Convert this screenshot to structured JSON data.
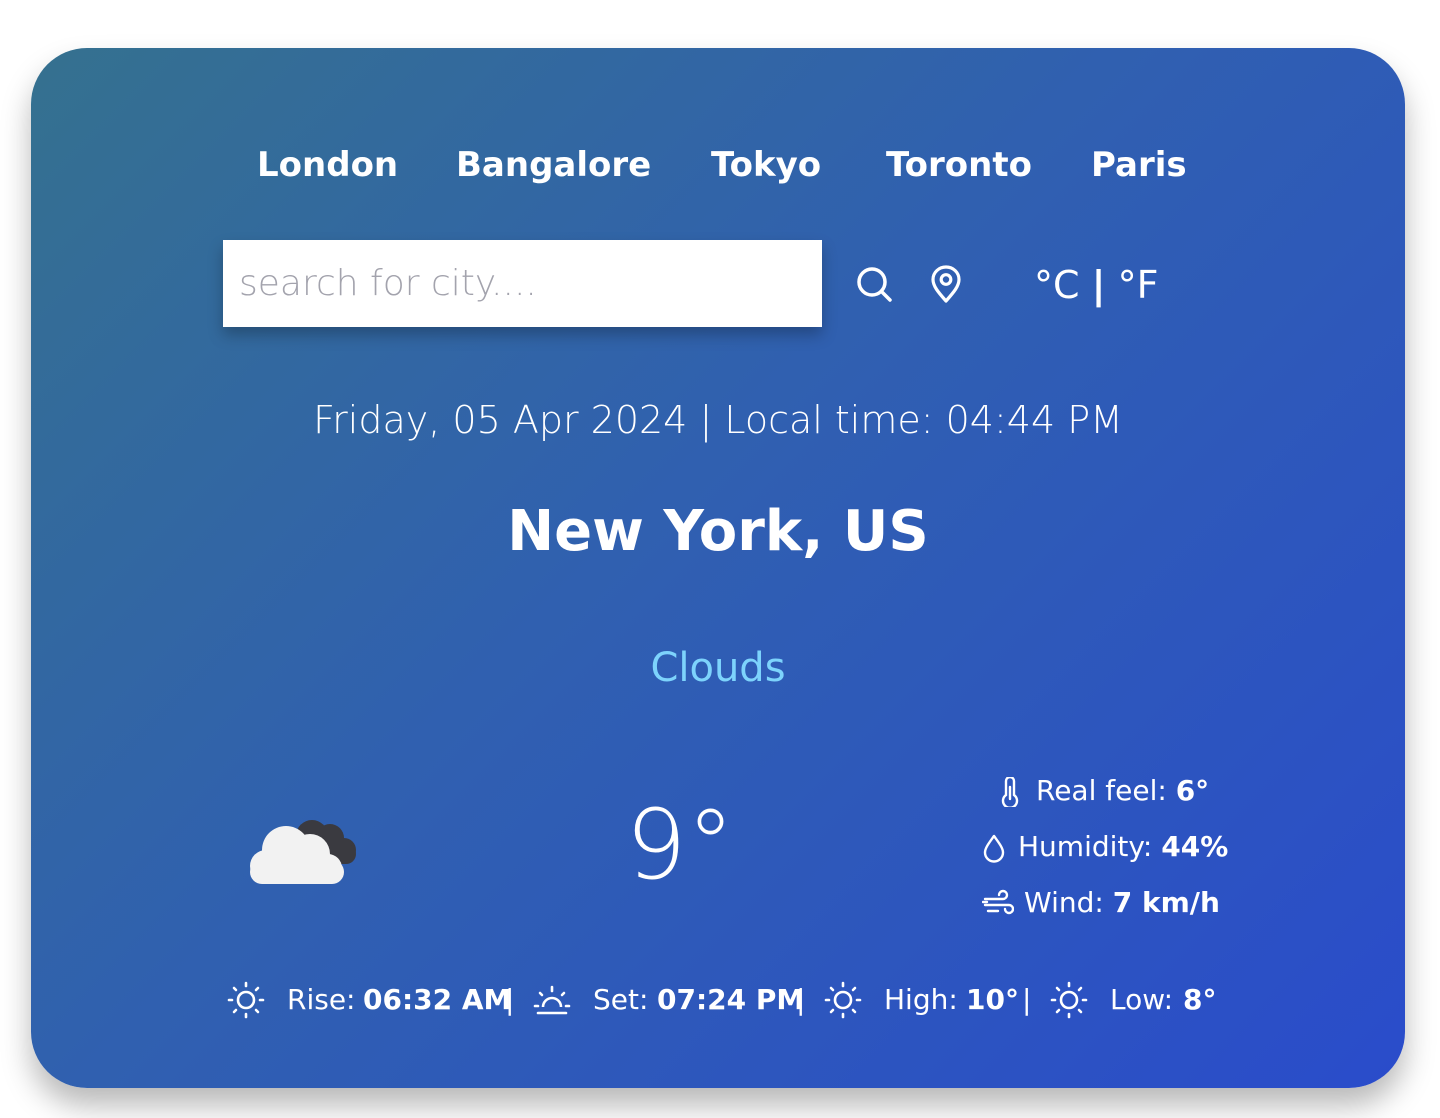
{
  "nav": {
    "cities": [
      "London",
      "Bangalore",
      "Tokyo",
      "Toronto",
      "Paris"
    ]
  },
  "search": {
    "placeholder": "search for city....",
    "search_icon": "search-icon",
    "location_icon": "map-pin-icon"
  },
  "units": {
    "celsius": "°C",
    "separator": "|",
    "fahrenheit": "°F"
  },
  "date_line": "Friday, 05 Apr 2024 | Local time: 04:44 PM",
  "location": "New York, US",
  "condition": "Clouds",
  "condition_color": "#7dd3fc",
  "current": {
    "icon": "cloudy-icon",
    "temperature": "9°"
  },
  "details": {
    "real_feel_label": "Real feel:",
    "real_feel_value": "6°",
    "humidity_label": "Humidity:",
    "humidity_value": "44%",
    "wind_label": "Wind:",
    "wind_value": "7 km/h"
  },
  "bottom": {
    "rise_label": "Rise:",
    "rise_value": "06:32 AM",
    "set_label": "Set:",
    "set_value": "07:24 PM",
    "high_label": "High:",
    "high_value": "10°",
    "low_label": "Low:",
    "low_value": "8°",
    "separator": "|"
  },
  "colors": {
    "gradient_start": "#35718f",
    "gradient_end": "#2a4ccb",
    "text": "#ffffff"
  }
}
